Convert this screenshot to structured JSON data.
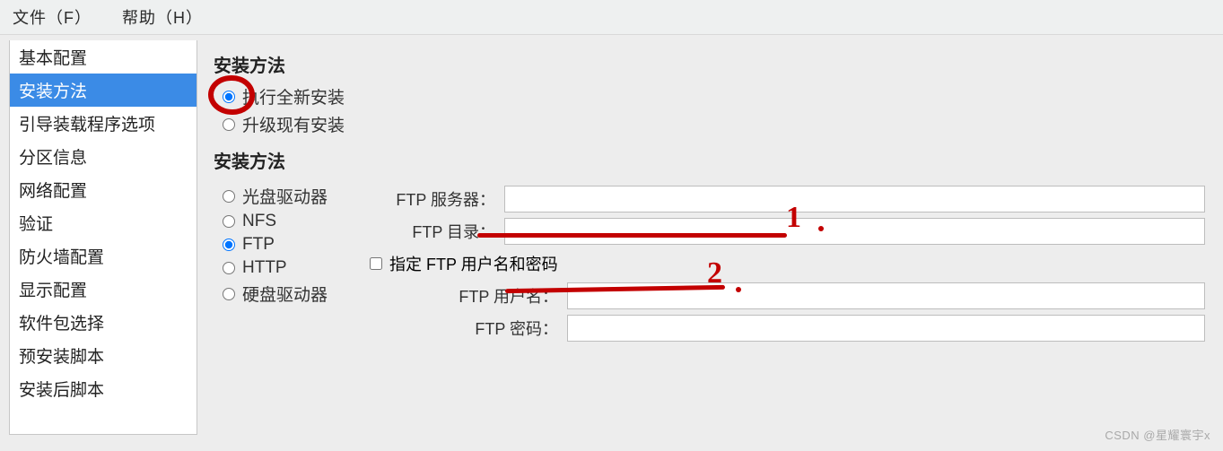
{
  "menu": {
    "file": "文件（F）",
    "help": "帮助（H）"
  },
  "sidebar": {
    "items": [
      "基本配置",
      "安装方法",
      "引导装载程序选项",
      "分区信息",
      "网络配置",
      "验证",
      "防火墙配置",
      "显示配置",
      "软件包选择",
      "预安装脚本",
      "安装后脚本"
    ],
    "selected_index": 1
  },
  "section1": {
    "title": "安装方法",
    "opt_fresh": "执行全新安装",
    "opt_upgrade": "升级现有安装"
  },
  "section2": {
    "title": "安装方法",
    "opt_cd": "光盘驱动器",
    "opt_nfs": "NFS",
    "opt_ftp": "FTP",
    "opt_http": "HTTP",
    "opt_hdd": "硬盘驱动器"
  },
  "ftp": {
    "server_label": "FTP 服务器：",
    "server_value": "",
    "dir_label": "FTP 目录：",
    "dir_value": "",
    "specify_creds": "指定 FTP 用户名和密码",
    "user_label": "FTP 用户名：",
    "user_value": "",
    "pass_label": "FTP 密码：",
    "pass_value": ""
  },
  "watermark": "CSDN @星耀寰宇x",
  "annotations": {
    "mark1": "1",
    "mark2": "2"
  }
}
